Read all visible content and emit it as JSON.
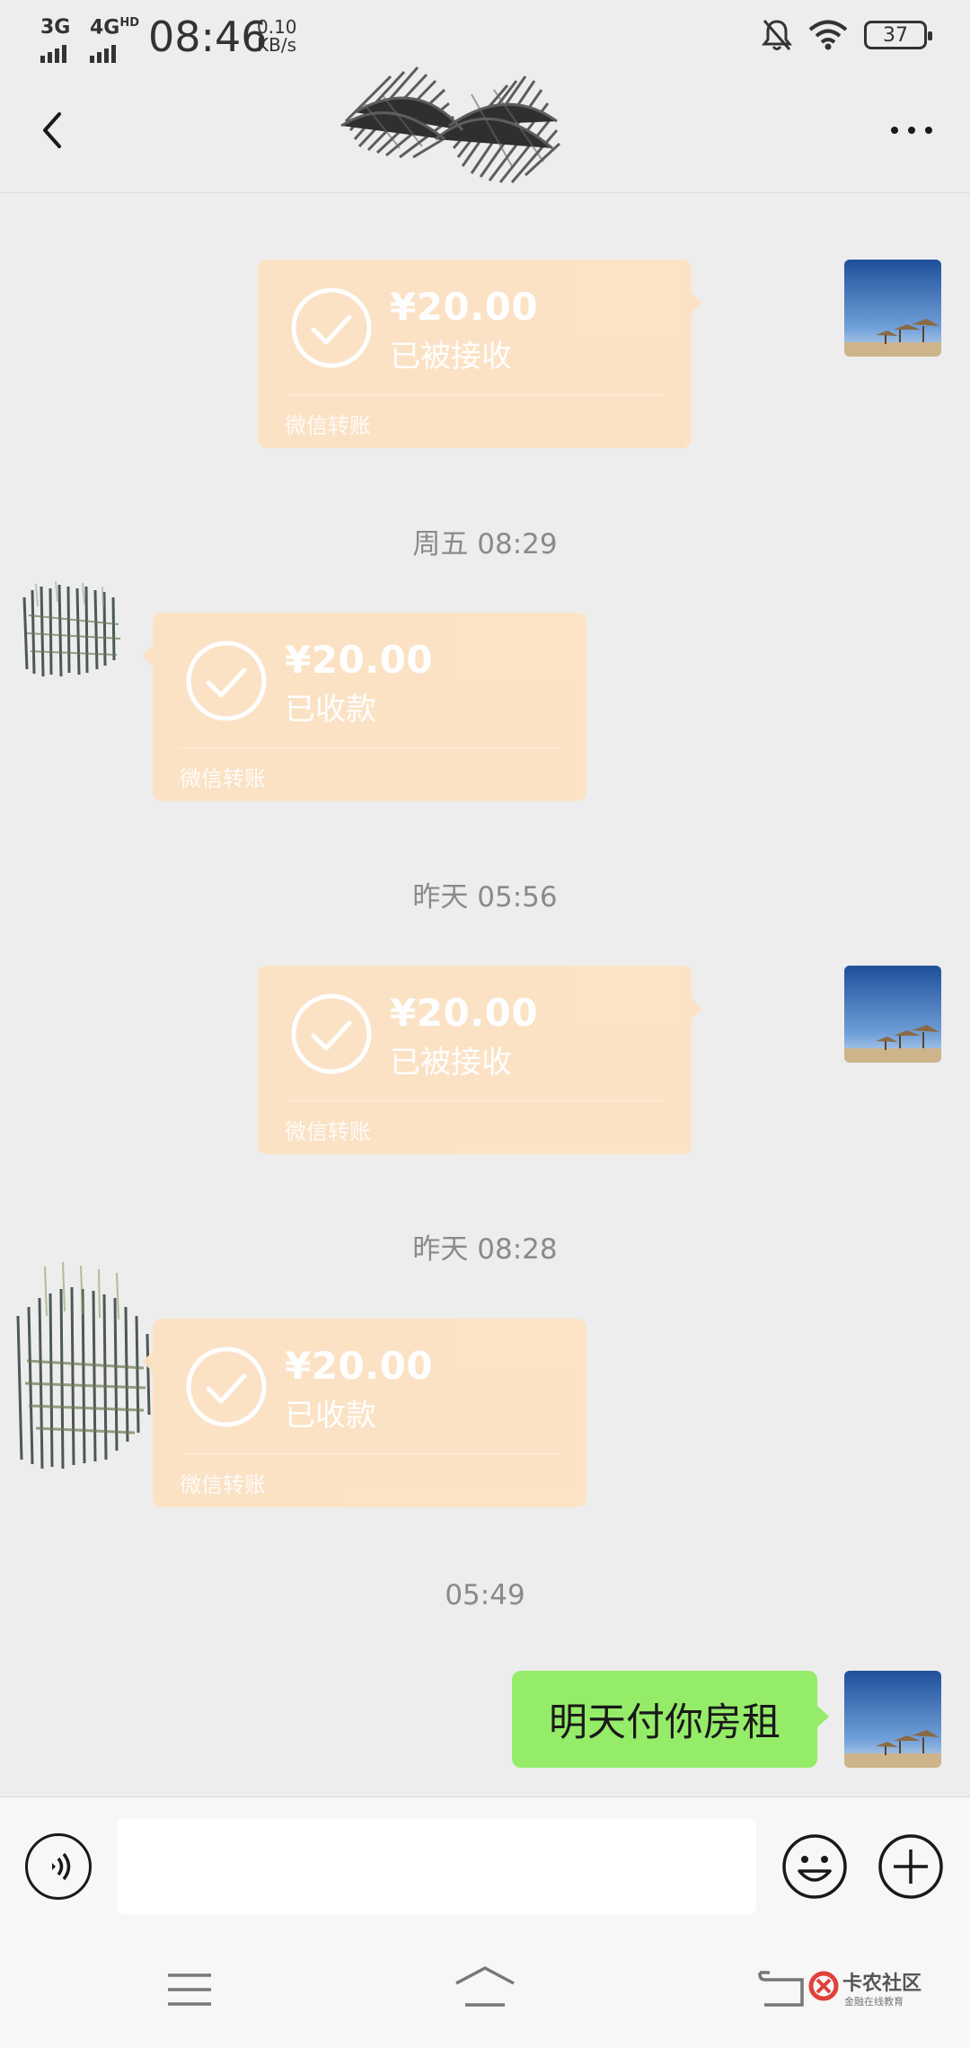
{
  "status_bar": {
    "network_1": "3G",
    "network_2": "4G",
    "network_2_sup": "HD",
    "time": "08:46",
    "speed_value": "0.10",
    "speed_unit": "KB/s",
    "battery": "37"
  },
  "header": {
    "title": ""
  },
  "messages": [
    {
      "type": "transfer",
      "direction": "out",
      "timestamp": "",
      "amount": "¥20.00",
      "status": "已被接收",
      "label": "微信转账"
    },
    {
      "type": "transfer",
      "direction": "in",
      "timestamp": "周五 08:29",
      "amount": "¥20.00",
      "status": "已收款",
      "label": "微信转账"
    },
    {
      "type": "transfer",
      "direction": "out",
      "timestamp": "昨天 05:56",
      "amount": "¥20.00",
      "status": "已被接收",
      "label": "微信转账"
    },
    {
      "type": "transfer",
      "direction": "in",
      "timestamp": "昨天 08:28",
      "amount": "¥20.00",
      "status": "已收款",
      "label": "微信转账"
    },
    {
      "type": "text",
      "direction": "out",
      "timestamp": "05:49",
      "text": "明天付你房租"
    }
  ],
  "input_bar": {
    "value": ""
  },
  "watermark": {
    "title": "卡农社区",
    "subtitle": "金融在线教育"
  },
  "colors": {
    "transfer_bubble": "#fce2c4",
    "text_bubble": "#95ec69",
    "background": "#ededed"
  }
}
